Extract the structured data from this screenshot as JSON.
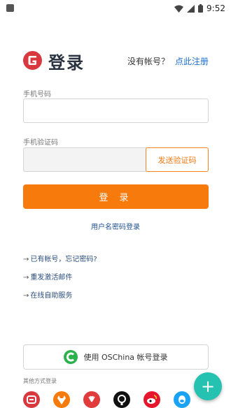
{
  "status_bar": {
    "time": "9:52"
  },
  "header": {
    "title": "登录",
    "register_prompt": "没有帐号？",
    "register_link": "点此注册"
  },
  "form": {
    "phone_label": "手机号码",
    "phone_value": "",
    "code_label": "手机验证码",
    "code_value": "",
    "send_code_label": "发送验证码",
    "login_label": "登 录",
    "alt_login_label": "用户名密码登录"
  },
  "help_links": [
    {
      "arrow": "→",
      "label": "已有帐号，忘记密码?"
    },
    {
      "arrow": "→",
      "label": "重发激活邮件"
    },
    {
      "arrow": "→",
      "label": "在线自助服务"
    }
  ],
  "third_party": {
    "oschina_label": "使用 OSChina 帐号登录",
    "other_label": "其他方式登录",
    "providers": [
      {
        "icon": "gitee-icon",
        "color": "#d9393e"
      },
      {
        "icon": "gitlab-icon",
        "color": "#f77a0d"
      },
      {
        "icon": "huawei-icon",
        "color": "#e23b3b"
      },
      {
        "icon": "github-icon",
        "color": "#111111"
      },
      {
        "icon": "weibo-icon",
        "color": "#e6162d"
      },
      {
        "icon": "qq-icon",
        "color": "#1aa3f5"
      }
    ]
  },
  "colors": {
    "accent": "#f77a0d",
    "link": "#1e6fd0",
    "fab": "#25c2b1"
  },
  "fab": {
    "label": "+"
  }
}
